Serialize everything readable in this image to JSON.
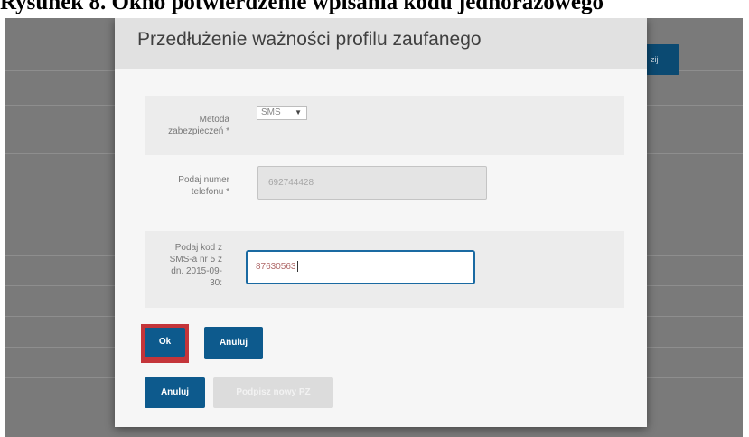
{
  "caption": "Rysunek 8. Okno potwierdzenie wpisania kodu jednorazowego",
  "background": {
    "button_label": "zij"
  },
  "dialog": {
    "title": "Przedłużenie ważności profilu zaufanego",
    "fields": {
      "method": {
        "label": "Metoda zabezpieczeń *",
        "selected": "SMS"
      },
      "phone": {
        "label": "Podaj numer telefonu *",
        "value": "692744428"
      },
      "code": {
        "label": "Podaj kod z SMS-a nr 5 z dn. 2015-09-30:",
        "value": "87630563"
      }
    },
    "buttons": {
      "ok": "Ok",
      "cancel_inner": "Anuluj",
      "cancel_outer": "Anuluj",
      "new_pz": "Podpisz nowy PZ"
    }
  },
  "colors": {
    "primary_button": "#0d5a8d",
    "highlight_frame": "#c4353a",
    "active_input_border": "#1a6aa2"
  }
}
